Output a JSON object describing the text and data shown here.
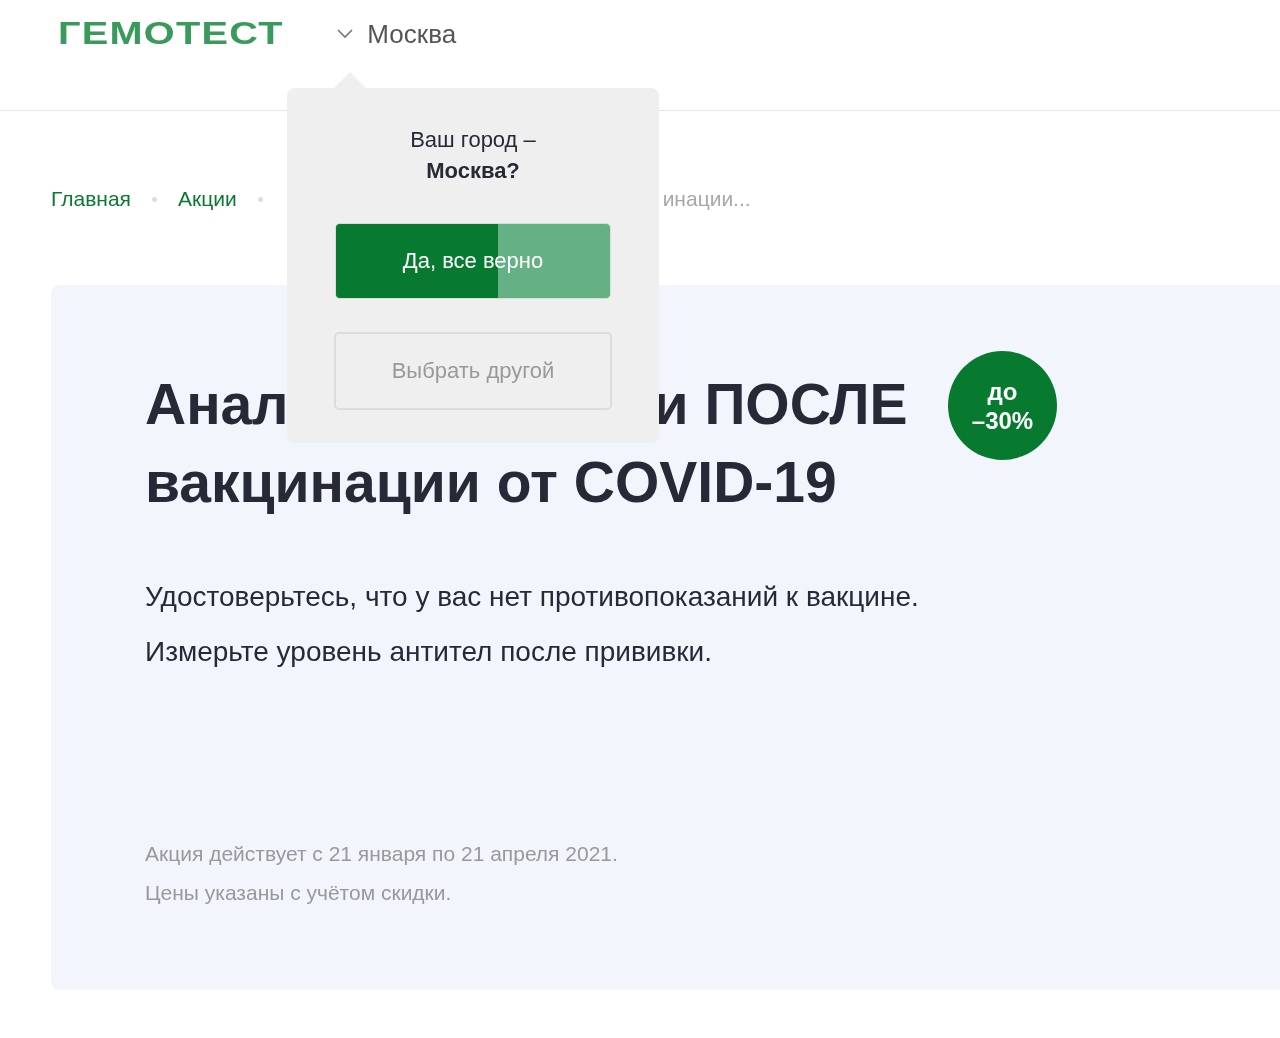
{
  "header": {
    "logo": "ГЕМОТЕСТ",
    "city": "Москва"
  },
  "breadcrumbs": [
    {
      "label": "Главная",
      "kind": "link"
    },
    {
      "label": "Акции",
      "kind": "link"
    },
    {
      "label": "инации...",
      "kind": "current"
    }
  ],
  "promo": {
    "title_first_line": [
      "Анал",
      "и ПОСЛЕ"
    ],
    "title_second_line": "вакцинации от COVID-19",
    "badge": [
      "до",
      "–30%"
    ],
    "description": [
      "Удостоверьтесь, что у вас нет противопоказаний к вакцине.",
      "Измерьте уровень антител после прививки."
    ],
    "notes": [
      "Акция действует с 21 января по 21 апреля 2021.",
      "Цены указаны с учётом скидки."
    ]
  },
  "city_popup": {
    "question": "Ваш город –",
    "city": "Москва?",
    "confirm": {
      "label": "Да, все верно",
      "level": 0.59
    },
    "other": "Выбрать другой"
  }
}
